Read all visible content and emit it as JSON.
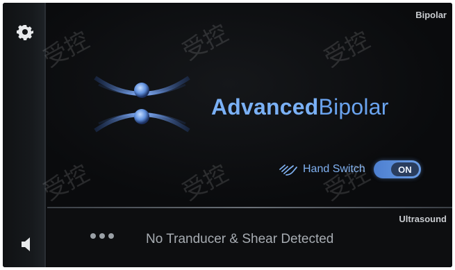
{
  "top_panel": {
    "mode_label": "Bipolar",
    "brand_bold": "Advanced",
    "brand_light": "Bipolar",
    "hand_switch": {
      "label": "Hand Switch",
      "state": "ON"
    }
  },
  "bottom_panel": {
    "mode_label": "Ultrasound",
    "status": "No Tranducer & Shear Detected"
  },
  "sidebar": {
    "icons": [
      "gear-icon",
      "speaker-icon"
    ]
  },
  "watermark_text": "受控",
  "colors": {
    "accent": "#6aa3ee",
    "toggle": "#5a8de0",
    "background": "#0b0c0e"
  }
}
